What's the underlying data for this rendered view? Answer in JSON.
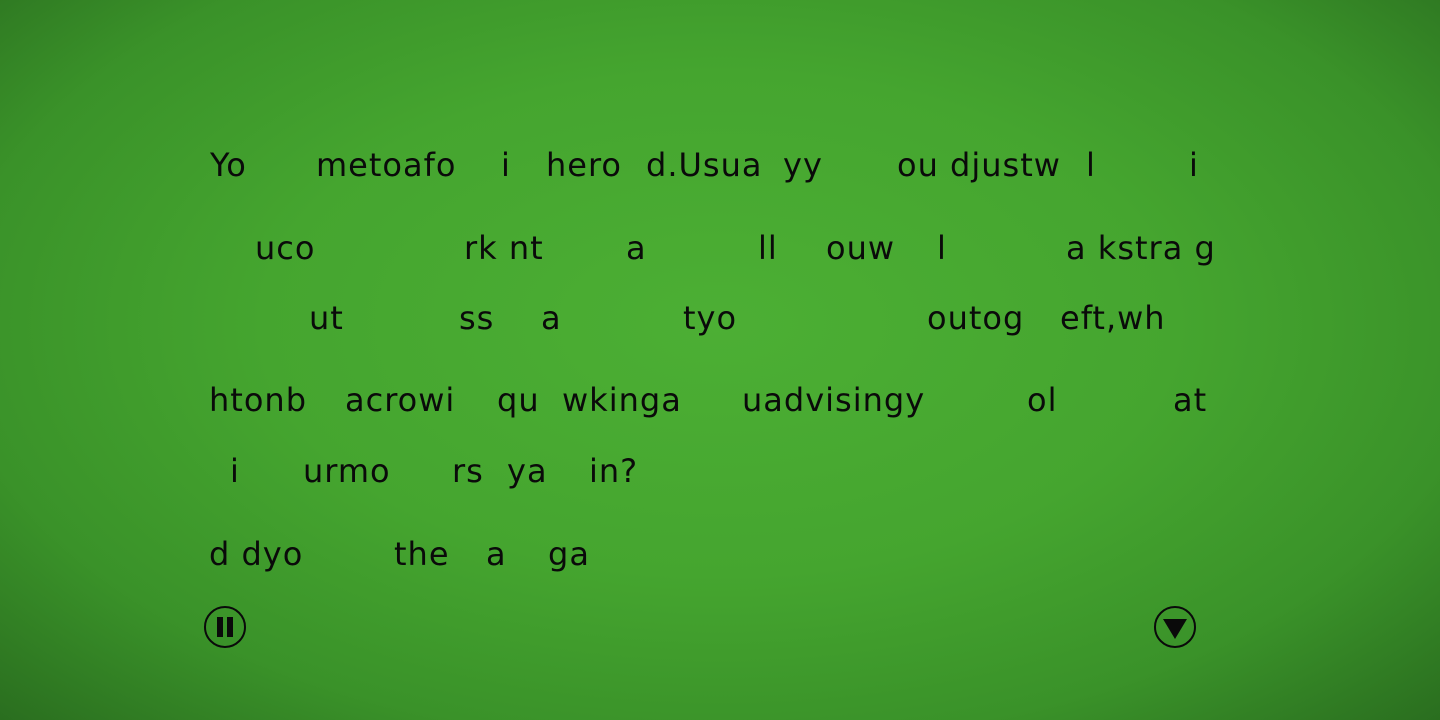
{
  "lines": [
    [
      "Yo",
      "metoafo",
      "i",
      "hero",
      "d.Usua",
      "yy",
      "ou djustw",
      "l",
      "i"
    ],
    [
      "uco",
      "rk nt",
      "a",
      "ll",
      "ouw",
      "l",
      "a kstra g"
    ],
    [
      "ut",
      "ss",
      "a",
      "tyo",
      "outog",
      "eft,wh"
    ],
    [
      "htonb",
      "acrowi",
      "qu",
      "wkinga",
      "uadvisingy",
      "ol",
      "at"
    ],
    [
      "i",
      "urmo",
      "rs",
      "ya",
      "in?"
    ],
    [
      "d dyo",
      "the",
      "a",
      "ga"
    ]
  ],
  "controls": {
    "pause_icon": "pause-icon",
    "next_icon": "down-triangle-icon"
  }
}
